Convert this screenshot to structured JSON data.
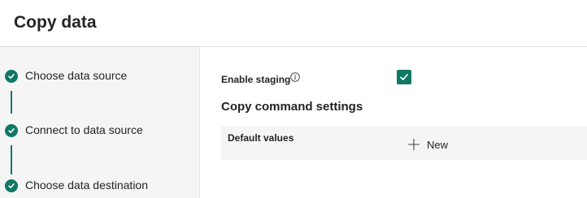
{
  "header": {
    "title": "Copy data"
  },
  "steps": [
    {
      "label": "Choose data source",
      "status": "complete"
    },
    {
      "label": "Connect to data source",
      "status": "complete"
    },
    {
      "label": "Choose data destination",
      "status": "complete"
    }
  ],
  "settings": {
    "enable_staging_label": "Enable staging",
    "enable_staging_checked": true,
    "section_title": "Copy command settings",
    "default_values_label": "Default values",
    "new_button_label": "New"
  },
  "colors": {
    "accent": "#117865",
    "sidebar_bg": "#f5f5f5",
    "row_bg": "#f5f5f5"
  },
  "icons": {
    "step_status": "checkmark-circle-icon",
    "info": "info-icon",
    "checkbox": "checkmark-icon",
    "new": "plus-icon"
  }
}
